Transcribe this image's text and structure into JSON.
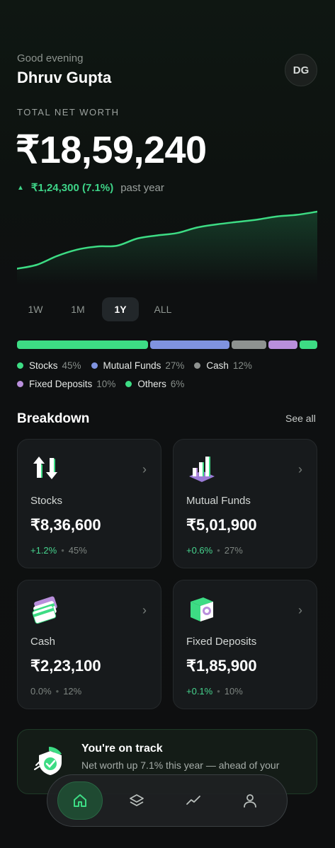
{
  "header": {
    "greeting": "Good evening",
    "user_name": "Dhruv Gupta",
    "avatar_initials": "DG"
  },
  "net_worth": {
    "label": "TOTAL NET WORTH",
    "value": "₹18,59,240",
    "change_amount": "₹1,24,300 (7.1%)",
    "change_period": "past year",
    "trend": "up"
  },
  "range_tabs": {
    "items": [
      "1W",
      "1M",
      "1Y",
      "ALL"
    ],
    "selected": "1Y"
  },
  "allocation": [
    {
      "name": "Stocks",
      "pct": "45%",
      "share": 45,
      "color": "#3ddc84"
    },
    {
      "name": "Mutual Funds",
      "pct": "27%",
      "share": 27,
      "color": "#7f93e0"
    },
    {
      "name": "Cash",
      "pct": "12%",
      "share": 12,
      "color": "#8e9290"
    },
    {
      "name": "Fixed Deposits",
      "pct": "10%",
      "share": 10,
      "color": "#b98fdc"
    },
    {
      "name": "Others",
      "pct": "6%",
      "share": 6,
      "color": "#3ddc84"
    }
  ],
  "breakdown": {
    "title": "Breakdown",
    "see_all": "See all",
    "cards": [
      {
        "label": "Stocks",
        "value": "₹8,36,600",
        "change": "+1.2%",
        "share": "45%",
        "icon": "stocks-arrows-icon"
      },
      {
        "label": "Mutual Funds",
        "value": "₹5,01,900",
        "change": "+0.6%",
        "share": "27%",
        "icon": "bar-chart-icon"
      },
      {
        "label": "Cash",
        "value": "₹2,23,100",
        "change": "0.0%",
        "share": "12%",
        "icon": "cards-icon"
      },
      {
        "label": "Fixed Deposits",
        "value": "₹1,85,900",
        "change": "+0.1%",
        "share": "10%",
        "icon": "safe-icon"
      }
    ]
  },
  "on_track": {
    "title": "You're on track",
    "subtitle": "Net worth up 7.1% this year — ahead of your",
    "icon": "shield-check-icon"
  },
  "bottom_nav": {
    "items": [
      "home-icon",
      "layers-icon",
      "trend-icon",
      "profile-icon"
    ],
    "active": "home-icon"
  },
  "chart_data": {
    "type": "area",
    "title": "",
    "series": [
      {
        "values": [
          20,
          25,
          36,
          44,
          48,
          49,
          58,
          62,
          65,
          72,
          76,
          79,
          82,
          86,
          88,
          92
        ]
      }
    ],
    "ylim": [
      0,
      100
    ],
    "grid": false,
    "color": "#3ddc84"
  }
}
